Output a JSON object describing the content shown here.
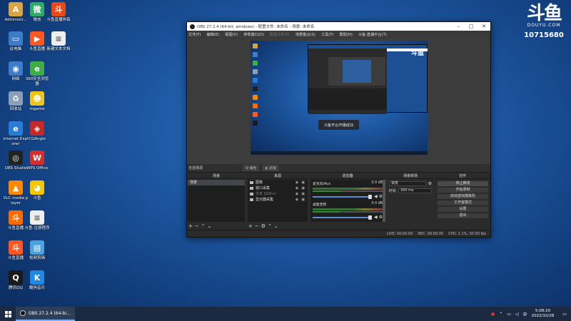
{
  "desktop": {
    "icons": [
      {
        "label": "Administr...",
        "color": "#d9a441",
        "glyph": "A"
      },
      {
        "label": "微信",
        "color": "#2aae67",
        "glyph": "微"
      },
      {
        "label": "斗鱼直播伴侣",
        "color": "#e64a19",
        "glyph": "斗"
      },
      {
        "label": "此电脑",
        "color": "#3d7cc9",
        "glyph": "▭"
      },
      {
        "label": "斗鱼直播",
        "color": "#ff5722",
        "glyph": "▶"
      },
      {
        "label": "新建文本文档",
        "color": "#eeeeee",
        "glyph": "≡"
      },
      {
        "label": "网络",
        "color": "#3d7cc9",
        "glyph": "◉"
      },
      {
        "label": "360安全浏览器",
        "color": "#3fae49",
        "glyph": "e"
      },
      {
        "label": "回收站",
        "color": "#8aa0b8",
        "glyph": "♻"
      },
      {
        "label": "mgame",
        "color": "#f0c419",
        "glyph": "☻"
      },
      {
        "label": "Internet Explorer",
        "color": "#2a7bd6",
        "glyph": "e"
      },
      {
        "label": "CGAngle",
        "color": "#c62828",
        "glyph": "◈"
      },
      {
        "label": "OBS Studio",
        "color": "#222222",
        "glyph": "◎"
      },
      {
        "label": "WPS Office",
        "color": "#d32f2f",
        "glyph": "W"
      },
      {
        "label": "VLC media player",
        "color": "#ff8800",
        "glyph": "▲"
      },
      {
        "label": "斗鱼",
        "color": "#f7c600",
        "glyph": "◕"
      },
      {
        "label": "斗鱼直播",
        "color": "#ff6a00",
        "glyph": "斗"
      },
      {
        "label": "斗鱼-注册程序",
        "color": "#eeeeee",
        "glyph": "≡"
      },
      {
        "label": "斗鱼直播",
        "color": "#ff5722",
        "glyph": "斗"
      },
      {
        "label": "视频剪辑",
        "color": "#4aa3df",
        "glyph": "▤"
      },
      {
        "label": "腾讯QQ",
        "color": "#1a1a1a",
        "glyph": "Q"
      },
      {
        "label": "酷狗音乐",
        "color": "#1e88e5",
        "glyph": "K"
      }
    ]
  },
  "watermark": {
    "logo": "斗鱼",
    "sub": "DOUYU.COM",
    "room_id": "10715680"
  },
  "obs": {
    "title": "OBS 27.2.4 (64-bit, windows) - 配置文件: 未命名 - 场景: 未命名",
    "menu": [
      "文件(F)",
      "编辑(E)",
      "视图(V)",
      "停靠窗口(D)",
      "配置文件(P)",
      "场景集合(S)",
      "工具(T)",
      "帮助(H)",
      "斗鱼·直播平台(T)"
    ],
    "menu_dim_index": 4,
    "toast": "斗鱼平台开播成功",
    "src_bar": {
      "selected": "无选择源",
      "props": "⚙ 属性",
      "filters": "◐ 滤镜"
    },
    "docks": {
      "scenes": {
        "title": "场景",
        "items": [
          "场景"
        ]
      },
      "sources": {
        "title": "来源",
        "items": [
          {
            "name": "图像",
            "dim": false
          },
          {
            "name": "窗口采集",
            "dim": false
          },
          {
            "name": "文本 (GDI+)",
            "dim": true
          },
          {
            "name": "显示器采集",
            "dim": false
          }
        ]
      },
      "mixer": {
        "title": "混音器",
        "channels": [
          {
            "name": "麦克风/Aux",
            "db": "0.0 dB"
          },
          {
            "name": "桌面音频",
            "db": "0.0 dB"
          }
        ]
      },
      "transitions": {
        "title": "场景转场",
        "type": "渐变",
        "duration_label": "时长",
        "duration": "300 ms"
      },
      "controls": {
        "title": "控件",
        "buttons": [
          "停止推流",
          "开始录制",
          "启动虚拟摄像机",
          "工作室模式",
          "设置",
          "退出"
        ]
      }
    },
    "status": {
      "live": "LIVE: 00:00:00",
      "rec": "REC: 00:00:00",
      "cpu": "CPU: 2.1%, 30.00 fps"
    }
  },
  "taskbar": {
    "app_label": "OBS 27.2.4 (64-bi...",
    "time": "5:08:20",
    "date": "2022/10/28"
  }
}
